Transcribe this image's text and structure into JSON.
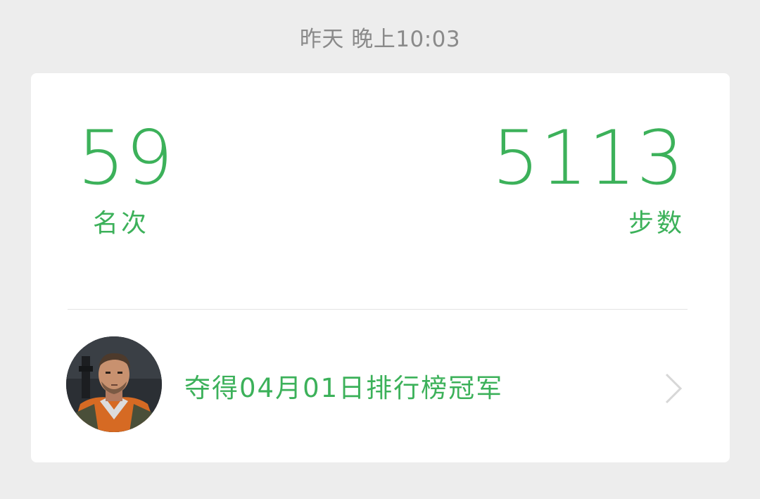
{
  "header": {
    "timestamp": "昨天 晚上10:03"
  },
  "stats": {
    "rank": {
      "value": "59",
      "label": "名次"
    },
    "steps": {
      "value": "5113",
      "label": "步数"
    }
  },
  "champion": {
    "text": "夺得04月01日排行榜冠军",
    "avatar_icon": "user-avatar",
    "chevron_icon": "chevron-right-icon"
  },
  "colors": {
    "accent": "#3cb15a",
    "background": "#ededed",
    "card": "#ffffff",
    "timestamp": "#8a8a8a"
  }
}
